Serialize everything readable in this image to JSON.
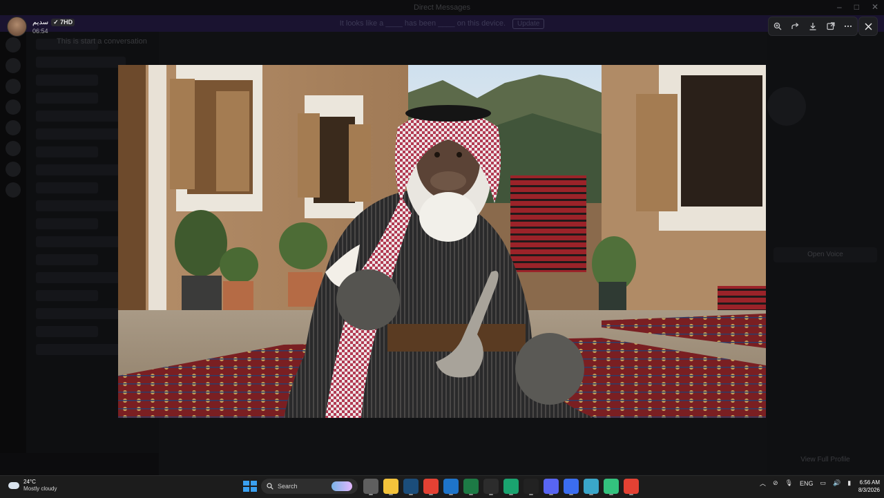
{
  "window": {
    "title": "Direct Messages"
  },
  "banner": {
    "text": "It looks like a ____ has been ____ on this device.",
    "button": "Update"
  },
  "background": {
    "dm_header": "This is start a conversation"
  },
  "lightbox": {
    "user": {
      "name": "سديم",
      "badge": "7HD",
      "time": "06:54"
    },
    "toolbar": {
      "zoom": "zoom-in-icon",
      "forward": "forward-icon",
      "download": "download-icon",
      "open": "open-in-browser-icon",
      "more": "more-icon"
    },
    "close": "close-icon"
  },
  "profile_panel": {
    "button": "Open Voice",
    "view_profile": "View Full Profile"
  },
  "taskbar": {
    "weather": {
      "temp": "24°C",
      "desc": "Mostly cloudy"
    },
    "search_label": "Search",
    "apps": [
      {
        "name": "task-view",
        "color": "#5f5f5f"
      },
      {
        "name": "file-explorer",
        "color": "#f3c33b"
      },
      {
        "name": "steam",
        "color": "#1b4d7a"
      },
      {
        "name": "chrome",
        "color": "#e34133"
      },
      {
        "name": "outlook",
        "color": "#1e74c9"
      },
      {
        "name": "excel",
        "color": "#1d7a45"
      },
      {
        "name": "capcut",
        "color": "#2c2c2c"
      },
      {
        "name": "edge",
        "color": "#1aa36f"
      },
      {
        "name": "g-app",
        "color": "#222222"
      },
      {
        "name": "discord",
        "color": "#5865f2"
      },
      {
        "name": "roblox",
        "color": "#3b6df0"
      },
      {
        "name": "pinwheel",
        "color": "#3aa6c9"
      },
      {
        "name": "robot-app",
        "color": "#33c27e"
      },
      {
        "name": "chrome-profile",
        "color": "#e34133"
      }
    ],
    "tray": {
      "lang": "ENG"
    },
    "clock": {
      "time": "6:56 AM",
      "date": "8/3/2026"
    }
  }
}
